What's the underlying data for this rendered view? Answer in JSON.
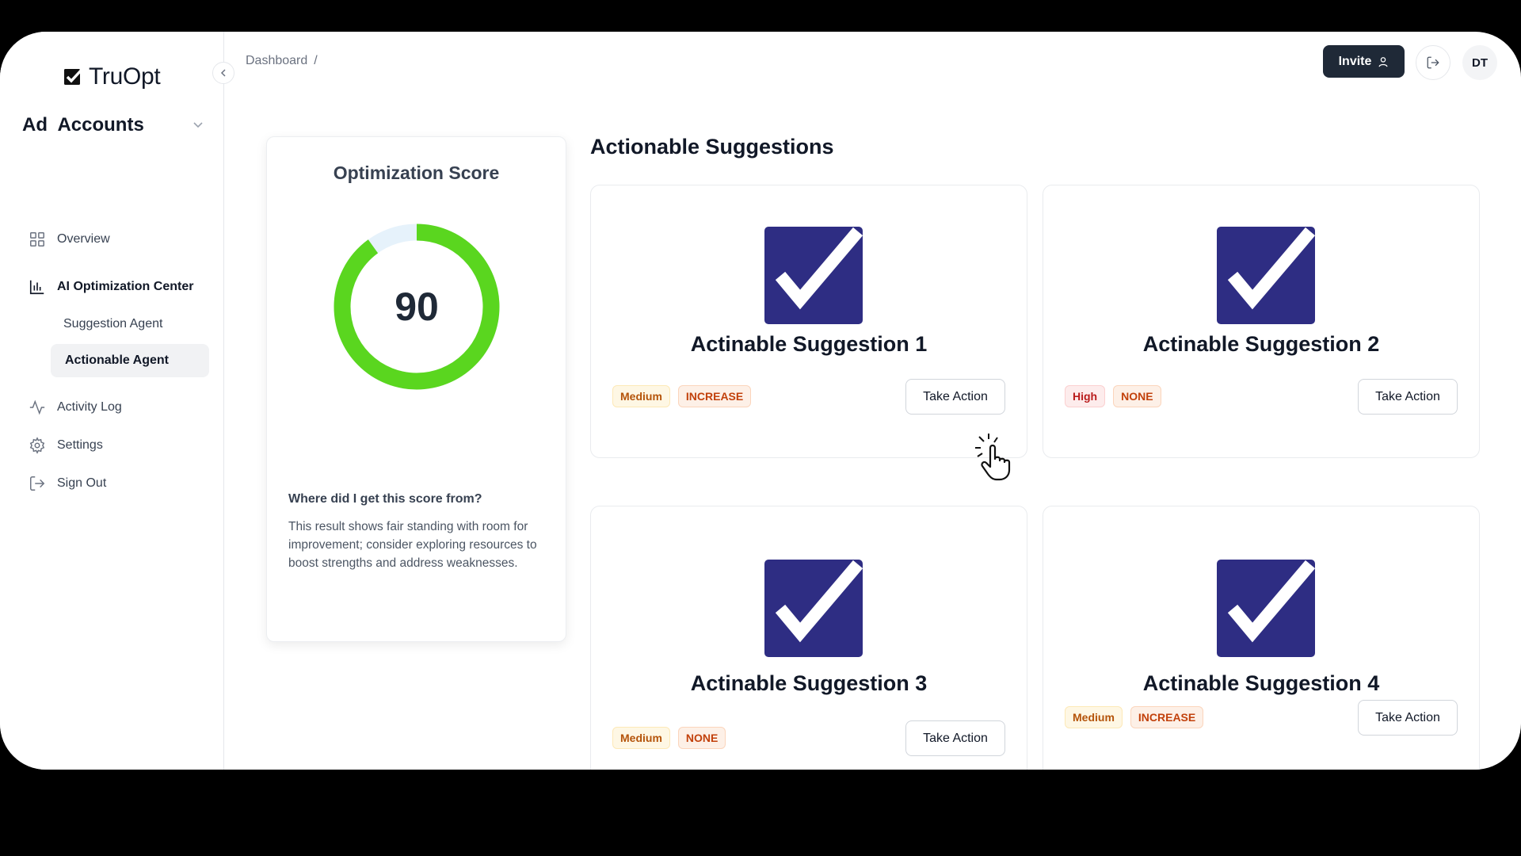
{
  "brand": {
    "name": "TruOpt"
  },
  "sidebar": {
    "account_label": "Ad  Accounts",
    "nav": [
      {
        "label": "Overview",
        "icon": "grid-icon"
      },
      {
        "label": "AI Optimization Center",
        "icon": "bar-chart-icon"
      },
      {
        "label": "Activity Log",
        "icon": "activity-icon"
      },
      {
        "label": "Settings",
        "icon": "gear-icon"
      },
      {
        "label": "Sign Out",
        "icon": "sign-out-icon"
      }
    ],
    "sub_nav": [
      {
        "label": "Suggestion Agent"
      },
      {
        "label": "Actionable Agent",
        "active": true
      }
    ]
  },
  "header": {
    "breadcrumb": "Dashboard",
    "breadcrumb_sep": "/",
    "invite_label": "Invite",
    "avatar_initials": "DT"
  },
  "score": {
    "title": "Optimization Score",
    "value": "90",
    "percent": 90,
    "question": "Where did I get this score from?",
    "description": "This result shows fair standing with room for improvement; consider exploring resources to boost strengths and address weaknesses.",
    "fill_color": "#5ad61f",
    "track_color": "#e6f2fb"
  },
  "suggestions": {
    "title": "Actionable Suggestions",
    "items": [
      {
        "title": "Actinable Suggestion 1",
        "priority": "Medium",
        "action": "INCREASE",
        "button": "Take Action"
      },
      {
        "title": "Actinable Suggestion 2",
        "priority": "High",
        "action": "NONE",
        "button": "Take Action"
      },
      {
        "title": "Actinable Suggestion 3",
        "priority": "Medium",
        "action": "NONE",
        "button": "Take Action"
      },
      {
        "title": "Actinable Suggestion 4",
        "priority": "Medium",
        "action": "INCREASE",
        "button": "Take Action"
      }
    ]
  },
  "colors": {
    "logo_navy": "#2e2d83"
  }
}
